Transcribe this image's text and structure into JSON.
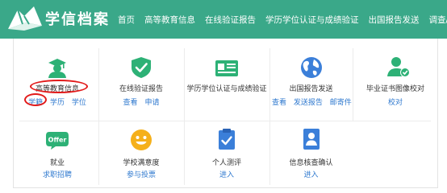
{
  "header": {
    "logo_text": "学信档案",
    "nav": [
      "首页",
      "高等教育信息",
      "在线验证报告",
      "学历学位认证与成绩验证",
      "出国报告发送",
      "调查/投票"
    ]
  },
  "services": [
    {
      "title": "高等教育信息",
      "links": [
        "学籍",
        "学历",
        "学位"
      ],
      "icon": "graduate-icon"
    },
    {
      "title": "在线验证报告",
      "links": [
        "查看",
        "申请"
      ],
      "icon": "shield-check-icon"
    },
    {
      "title": "学历学位认证与成绩验证",
      "links": [],
      "icon": "id-card-icon"
    },
    {
      "title": "出国报告发送",
      "links": [
        "查看",
        "发送报告",
        "邮寄件"
      ],
      "icon": "globe-icon"
    },
    {
      "title": "毕业证书图像校对",
      "links": [
        "校对"
      ],
      "icon": "user-check-icon"
    },
    {
      "title": "就业",
      "links": [
        "求职招聘"
      ],
      "icon": "offer-icon"
    },
    {
      "title": "学校满意度",
      "links": [
        "参与投票"
      ],
      "icon": "smiley-icon"
    },
    {
      "title": "个人测评",
      "links": [
        "进入"
      ],
      "icon": "clipboard-check-icon"
    },
    {
      "title": "信息核查确认",
      "links": [
        "进入"
      ],
      "icon": "person-doc-icon"
    }
  ],
  "colors": {
    "header": "#3aa889",
    "green": "#2db176",
    "blue": "#3b7fd9",
    "yellow": "#f5b01a",
    "link": "#2f79cf",
    "highlight": "#e21a1a"
  },
  "offer_label": "Offer"
}
